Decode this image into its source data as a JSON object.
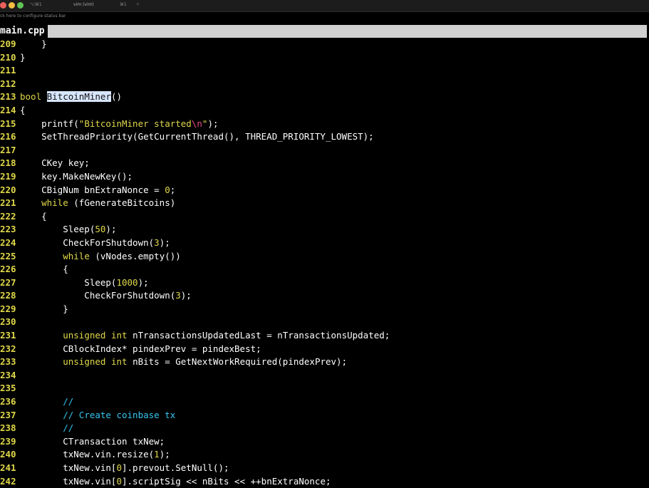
{
  "window": {
    "tab_shortcut_1": "⌥⌘1",
    "tab_title": "vim (vim)",
    "tab_shortcut_2": "⌘1",
    "tab_add": "+",
    "status_hint": "ck here to configure status bar"
  },
  "editor": {
    "buffer_name": "main.cpp",
    "colors": {
      "line_number": "#e0d84a",
      "keyword": "#e0d84a",
      "comment": "#36c5f0",
      "search_highlight": "#2f3bd9",
      "escape": "#e64a8a"
    },
    "lines": [
      {
        "n": "209",
        "t": "    }"
      },
      {
        "n": "210",
        "t": "}"
      },
      {
        "n": "211",
        "t": ""
      },
      {
        "n": "212",
        "t": ""
      },
      {
        "n": "213",
        "t": "bool BitcoinMiner()"
      },
      {
        "n": "214",
        "t": "{"
      },
      {
        "n": "215",
        "t": "    printf(\"BitcoinMiner started\\n\");"
      },
      {
        "n": "216",
        "t": "    SetThreadPriority(GetCurrentThread(), THREAD_PRIORITY_LOWEST);"
      },
      {
        "n": "217",
        "t": ""
      },
      {
        "n": "218",
        "t": "    CKey key;"
      },
      {
        "n": "219",
        "t": "    key.MakeNewKey();"
      },
      {
        "n": "220",
        "t": "    CBigNum bnExtraNonce = 0;"
      },
      {
        "n": "221",
        "t": "    while (fGenerateBitcoins)"
      },
      {
        "n": "222",
        "t": "    {"
      },
      {
        "n": "223",
        "t": "        Sleep(50);"
      },
      {
        "n": "224",
        "t": "        CheckForShutdown(3);"
      },
      {
        "n": "225",
        "t": "        while (vNodes.empty())"
      },
      {
        "n": "226",
        "t": "        {"
      },
      {
        "n": "227",
        "t": "            Sleep(1000);"
      },
      {
        "n": "228",
        "t": "            CheckForShutdown(3);"
      },
      {
        "n": "229",
        "t": "        }"
      },
      {
        "n": "230",
        "t": ""
      },
      {
        "n": "231",
        "t": "        unsigned int nTransactionsUpdatedLast = nTransactionsUpdated;"
      },
      {
        "n": "232",
        "t": "        CBlockIndex* pindexPrev = pindexBest;"
      },
      {
        "n": "233",
        "t": "        unsigned int nBits = GetNextWorkRequired(pindexPrev);"
      },
      {
        "n": "234",
        "t": ""
      },
      {
        "n": "235",
        "t": ""
      },
      {
        "n": "236",
        "t": "        //"
      },
      {
        "n": "237",
        "t": "        // Create coinbase tx"
      },
      {
        "n": "238",
        "t": "        //"
      },
      {
        "n": "239",
        "t": "        CTransaction txNew;"
      },
      {
        "n": "240",
        "t": "        txNew.vin.resize(1);"
      },
      {
        "n": "241",
        "t": "        txNew.vin[0].prevout.SetNull();"
      },
      {
        "n": "242",
        "t": "        txNew.vin[0].scriptSig << nBits << ++bnExtraNonce;"
      }
    ]
  }
}
